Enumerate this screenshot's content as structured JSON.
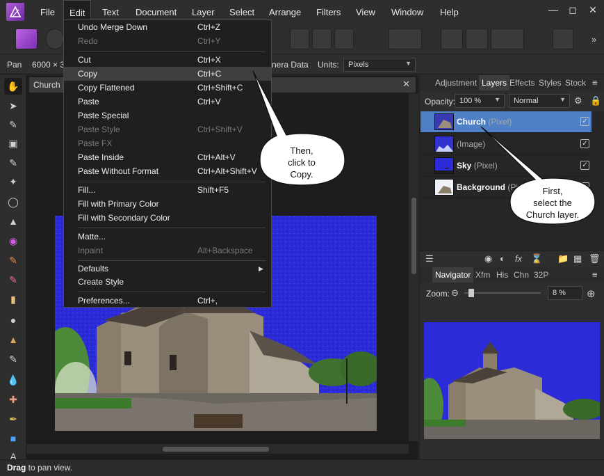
{
  "app": {
    "name": "Affinity Photo"
  },
  "menubar": {
    "items": [
      "File",
      "Edit",
      "Text",
      "Document",
      "Layer",
      "Select",
      "Arrange",
      "Filters",
      "View",
      "Window",
      "Help"
    ]
  },
  "context_toolbar": {
    "tool_label": "Pan",
    "dimensions": "6000 × 3",
    "camera_data": "nera Data",
    "units_label": "Units:",
    "units_value": "Pixels"
  },
  "document": {
    "tab_title": "Church [I"
  },
  "edit_menu": {
    "items": [
      {
        "label": "Undo Merge Down",
        "shortcut": "Ctrl+Z",
        "disabled": false
      },
      {
        "label": "Redo",
        "shortcut": "Ctrl+Y",
        "disabled": true
      },
      {
        "label": "Cut",
        "shortcut": "Ctrl+X",
        "disabled": false
      },
      {
        "label": "Copy",
        "shortcut": "Ctrl+C",
        "disabled": false
      },
      {
        "label": "Copy Flattened",
        "shortcut": "Ctrl+Shift+C",
        "disabled": false
      },
      {
        "label": "Paste",
        "shortcut": "Ctrl+V",
        "disabled": false
      },
      {
        "label": "Paste Special",
        "shortcut": "",
        "disabled": false
      },
      {
        "label": "Paste Style",
        "shortcut": "Ctrl+Shift+V",
        "disabled": true
      },
      {
        "label": "Paste FX",
        "shortcut": "",
        "disabled": true
      },
      {
        "label": "Paste Inside",
        "shortcut": "Ctrl+Alt+V",
        "disabled": false
      },
      {
        "label": "Paste Without Format",
        "shortcut": "Ctrl+Alt+Shift+V",
        "disabled": false
      },
      {
        "label": "Fill...",
        "shortcut": "Shift+F5",
        "disabled": false
      },
      {
        "label": "Fill with Primary Color",
        "shortcut": "",
        "disabled": false
      },
      {
        "label": "Fill with Secondary Color",
        "shortcut": "",
        "disabled": false
      },
      {
        "label": "Matte...",
        "shortcut": "",
        "disabled": false
      },
      {
        "label": "Inpaint",
        "shortcut": "Alt+Backspace",
        "disabled": true
      },
      {
        "label": "Defaults",
        "shortcut": "",
        "disabled": false
      },
      {
        "label": "Create Style",
        "shortcut": "",
        "disabled": false
      },
      {
        "label": "Preferences...",
        "shortcut": "Ctrl+,",
        "disabled": false
      }
    ]
  },
  "layers_panel": {
    "tabs": [
      "Adjustment",
      "Layers",
      "Effects",
      "Styles",
      "Stock"
    ],
    "opacity_label": "Opacity:",
    "opacity_value": "100 %",
    "blend_mode": "Normal",
    "layers": [
      {
        "name": "Church",
        "type": "(Pixel)",
        "bold": true
      },
      {
        "name": "",
        "type": "(Image)",
        "bold": false
      },
      {
        "name": "Sky",
        "type": "(Pixel)",
        "bold": true
      },
      {
        "name": "Background",
        "type": "(Pi",
        "bold": true
      }
    ]
  },
  "navigator_panel": {
    "tabs": [
      "Navigator",
      "Xfm",
      "His",
      "Chn",
      "32P"
    ],
    "zoom_label": "Zoom:",
    "zoom_value": "8 %"
  },
  "callouts": {
    "copy": [
      "Then,",
      "click to",
      "Copy."
    ],
    "layer": [
      "First,",
      "select the",
      "Church layer."
    ]
  },
  "status": {
    "bold": "Drag",
    "text": " to pan view."
  },
  "colors": {
    "selection": "#4f7fc4",
    "sky_blue": "#2b2bd8"
  }
}
